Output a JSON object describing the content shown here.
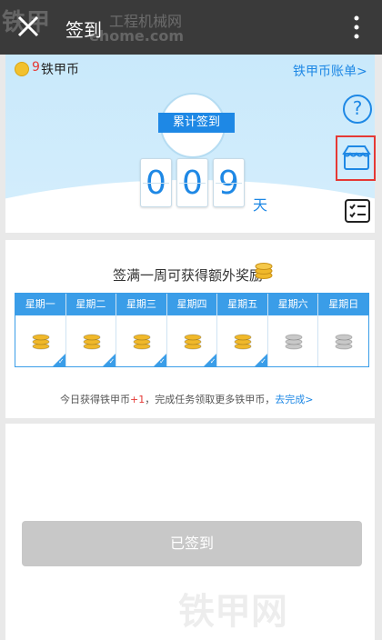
{
  "topbar": {
    "title": "签到",
    "watermark_brand": "铁甲",
    "watermark_site": "工程机械网",
    "watermark_domain": "ehome.com"
  },
  "header": {
    "coin_count": "9",
    "coin_label": "铁甲币",
    "account_link": "铁甲币账单>"
  },
  "streak": {
    "label": "累计签到",
    "digits": [
      "0",
      "0",
      "9"
    ],
    "unit": "天"
  },
  "side_icons": [
    "help-icon",
    "shop-icon",
    "task-list-icon"
  ],
  "week": {
    "title": "签满一周可获得额外奖励",
    "days": [
      {
        "label": "星期一",
        "signed": true
      },
      {
        "label": "星期二",
        "signed": true
      },
      {
        "label": "星期三",
        "signed": true
      },
      {
        "label": "星期四",
        "signed": true
      },
      {
        "label": "星期五",
        "signed": true
      },
      {
        "label": "星期六",
        "signed": false
      },
      {
        "label": "星期日",
        "signed": false
      }
    ],
    "coin_gold": "#f0b82a",
    "coin_gray": "#c8c8c8"
  },
  "today_note": {
    "prefix": "今日获得铁甲币",
    "plus": "+1",
    "middle": "，完成任务领取更多铁甲币，",
    "link": "去完成>"
  },
  "signed_button": "已签到",
  "watermark_bottom": "铁甲网",
  "colors": {
    "accent": "#1e88e5",
    "topbar": "#3a3a3a",
    "highlight": "#e53935"
  }
}
